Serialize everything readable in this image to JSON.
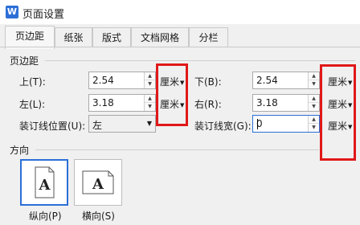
{
  "window": {
    "title": "页面设置",
    "app_icon_letter": "W"
  },
  "tabs": [
    {
      "label": "页边距",
      "active": true
    },
    {
      "label": "纸张",
      "active": false
    },
    {
      "label": "版式",
      "active": false
    },
    {
      "label": "文档网格",
      "active": false
    },
    {
      "label": "分栏",
      "active": false
    }
  ],
  "margins": {
    "section_title": "页边距",
    "top": {
      "label": "上(T):",
      "value": "2.54",
      "unit": "厘米"
    },
    "bottom": {
      "label": "下(B):",
      "value": "2.54",
      "unit": "厘米"
    },
    "left": {
      "label": "左(L):",
      "value": "3.18",
      "unit": "厘米"
    },
    "right": {
      "label": "右(R):",
      "value": "3.18",
      "unit": "厘米"
    },
    "gutter_position": {
      "label": "装订线位置(U):",
      "value": "左"
    },
    "gutter_width": {
      "label": "装订线宽(G):",
      "value": "0",
      "unit": "厘米"
    }
  },
  "orientation": {
    "section_title": "方向",
    "portrait": {
      "label": "纵向(P)",
      "glyph": "A",
      "selected": true
    },
    "landscape": {
      "label": "横向(S)",
      "glyph": "A",
      "selected": false
    }
  },
  "colors": {
    "highlight_box": "#e01818",
    "accent": "#2b6fd6"
  }
}
